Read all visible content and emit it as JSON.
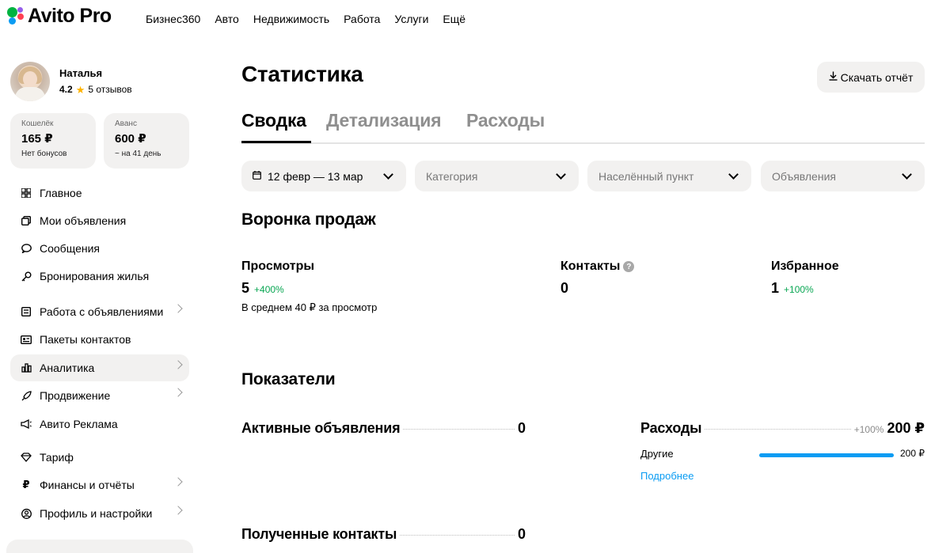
{
  "brand": {
    "logo_text": "Avito Pro",
    "colors": {
      "dot_green": "#00b341",
      "dot_blue": "#0a9cf3",
      "dot_red": "#ff4053",
      "dot_purple": "#965eeb",
      "accent": "#0a9cf3",
      "positive": "#08a652"
    }
  },
  "nav": [
    "Бизнес360",
    "Авто",
    "Недвижимость",
    "Работа",
    "Услуги",
    "Ещё"
  ],
  "profile": {
    "name": "Наталья",
    "rating": "4.2",
    "reviews": "5 отзывов"
  },
  "wallet": {
    "balance": {
      "label": "Кошелёк",
      "value": "165 ₽",
      "sub": "Нет бонусов"
    },
    "advance": {
      "label": "Аванс",
      "value": "600 ₽",
      "sub": "~ на 41 день"
    }
  },
  "sidebar": {
    "items": [
      {
        "label": "Главное",
        "icon": "grid-icon"
      },
      {
        "label": "Мои объявления",
        "icon": "copy-icon"
      },
      {
        "label": "Сообщения",
        "icon": "chat-icon"
      },
      {
        "label": "Бронирования жилья",
        "icon": "key-icon"
      },
      {
        "label": "Работа с объявлениями",
        "icon": "board-icon",
        "chevron": true
      },
      {
        "label": "Пакеты контактов",
        "icon": "id-card-icon"
      },
      {
        "label": "Аналитика",
        "icon": "bar-chart-icon",
        "chevron": true,
        "active": true
      },
      {
        "label": "Продвижение",
        "icon": "rocket-icon",
        "chevron": true
      },
      {
        "label": "Авито Реклама",
        "icon": "megaphone-icon"
      },
      {
        "label": "Тариф",
        "icon": "diamond-icon"
      },
      {
        "label": "Финансы и отчёты",
        "icon": "ruble-icon",
        "chevron": true
      },
      {
        "label": "Профиль и настройки",
        "icon": "user-circle-icon",
        "chevron": true
      }
    ]
  },
  "main": {
    "title": "Статистика",
    "download_label": "Скачать отчёт",
    "tabs": [
      "Сводка",
      "Детализация",
      "Расходы"
    ],
    "filters": {
      "period": "12 февр — 13 мар",
      "category": "Категория",
      "city": "Населённый пункт",
      "ads": "Объявления"
    },
    "funnel": {
      "title": "Воронка продаж",
      "views": {
        "label": "Просмотры",
        "value": "5",
        "delta": "+400%",
        "note": "В среднем 40 ₽ за просмотр"
      },
      "contacts": {
        "label": "Контакты",
        "value": "0",
        "help": "?"
      },
      "favorites": {
        "label": "Избранное",
        "value": "1",
        "delta": "+100%"
      }
    },
    "metrics": {
      "title": "Показатели",
      "active_ads": {
        "label": "Активные объявления",
        "value": "0"
      },
      "received_contacts": {
        "label": "Полученные контакты",
        "value": "0"
      },
      "expenses": {
        "label": "Расходы",
        "delta": "+100%",
        "value": "200 ₽",
        "lines": [
          {
            "label": "Другие",
            "value": "200 ₽",
            "share": 1.0
          }
        ],
        "more_label": "Подробнее"
      }
    }
  }
}
